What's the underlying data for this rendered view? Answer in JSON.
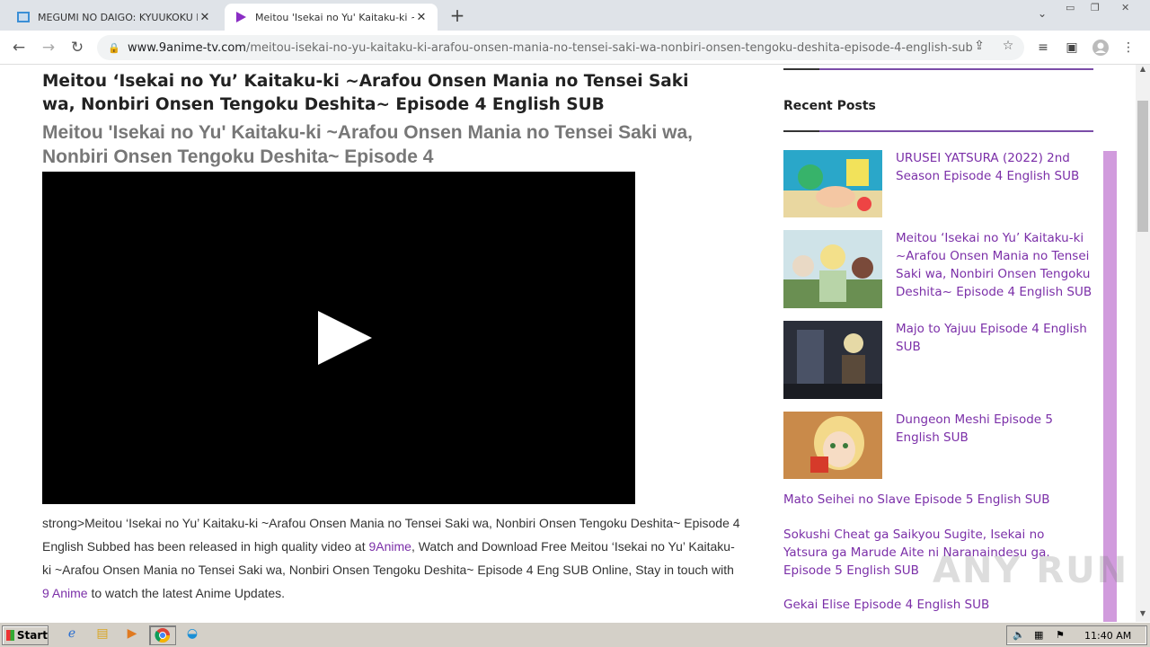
{
  "browser": {
    "tabs": [
      {
        "title": "MEGUMI NO DAIGO: KYUUKOKU NO",
        "active": false
      },
      {
        "title": "Meitou 'Isekai no Yu' Kaitaku-ki ~Ara",
        "active": true
      }
    ],
    "url_host": "www.9anime-tv.com",
    "url_path": "/meitou-isekai-no-yu-kaitaku-ki-arafou-onsen-mania-no-tensei-saki-wa-nonbiri-onsen-tengoku-deshita-episode-4-english-sub"
  },
  "post": {
    "title": "Meitou ‘Isekai no Yu’ Kaitaku-ki ~Arafou Onsen Mania no Tensei Saki wa, Nonbiri Onsen Tengoku Deshita~ Episode 4 English SUB",
    "subtitle": "Meitou 'Isekai no Yu' Kaitaku-ki ~Arafou Onsen Mania no Tensei Saki wa, Nonbiri Onsen Tengoku Deshita~ Episode 4",
    "para_1": "strong>Meitou ‘Isekai no Yu’ Kaitaku-ki ~Arafou Onsen Mania no Tensei Saki wa, Nonbiri Onsen Tengoku Deshita~ Episode 4 English Subbed has been released in high quality video at ",
    "link_1": "9Anime",
    "para_2": ", Watch and Download Free Meitou ‘Isekai no Yu’ Kaitaku-ki ~Arafou Onsen Mania no Tensei Saki wa, Nonbiri Onsen Tengoku Deshita~ Episode 4 Eng SUB Online, Stay in touch with ",
    "link_2": "9 Anime",
    "para_3": " to watch the latest Anime Updates."
  },
  "sidebar": {
    "heading": "Recent Posts",
    "thumb_posts": [
      {
        "title": "URUSEI YATSURA (2022) 2nd Season Episode 4 English SUB"
      },
      {
        "title": "Meitou ‘Isekai no Yu’ Kaitaku-ki ~Arafou Onsen Mania no Tensei Saki wa, Nonbiri Onsen Tengoku Deshita~ Episode 4 English SUB"
      },
      {
        "title": "Majo to Yajuu Episode 4 English SUB"
      },
      {
        "title": "Dungeon Meshi Episode 5 English SUB"
      }
    ],
    "text_posts": [
      "Mato Seihei no Slave Episode 5 English SUB",
      "Sokushi Cheat ga Saikyou Sugite, Isekai no Yatsura ga Marude Aite ni Naranaindesu ga. Episode 5 English SUB",
      "Gekai Elise Episode 4 English SUB"
    ]
  },
  "watermark": "ANY RUN",
  "taskbar": {
    "start_label": "Start",
    "clock": "11:40 AM"
  },
  "colors": {
    "link": "#7b2fa8",
    "accent_bar": "#d19bdd"
  }
}
